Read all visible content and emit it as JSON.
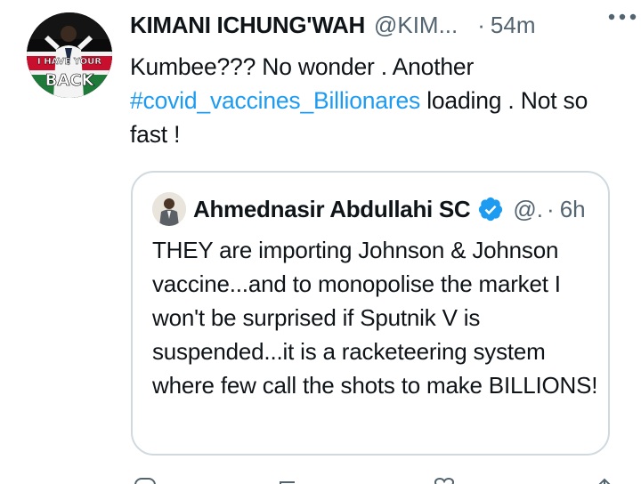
{
  "tweet": {
    "author_name": "KIMANI ICHUNG'WAH",
    "author_handle": "@KIM...",
    "separator": "·",
    "time": "54m",
    "avatar_text": [
      "I HAVE YOUR",
      "BACK"
    ],
    "text_before": "Kumbee??? No wonder . Another",
    "hashtag": "#covid_vaccines_Billionares",
    "text_after": "loading . Not so fast !",
    "more_icon": "more-horizontal-icon"
  },
  "quoted_tweet": {
    "author_name": "Ahmednasir Abdullahi SC",
    "verified_icon": "verified-badge-icon",
    "author_handle": "@.",
    "separator": "·",
    "time": "6h",
    "text": "THEY are importing Johnson & Johnson vaccine...and to monopolise the market I won't be surprised if Sputnik V is suspended...it is a racketeering system where few call the shots to make BILLIONS!"
  },
  "actions": [
    {
      "icon": "reply-icon"
    },
    {
      "icon": "retweet-icon"
    },
    {
      "icon": "like-icon"
    },
    {
      "icon": "share-icon"
    }
  ],
  "colors": {
    "link": "#1d9bf0",
    "secondary_text": "#536471",
    "border": "#cfd9de",
    "verified": "#1d9bf0"
  }
}
